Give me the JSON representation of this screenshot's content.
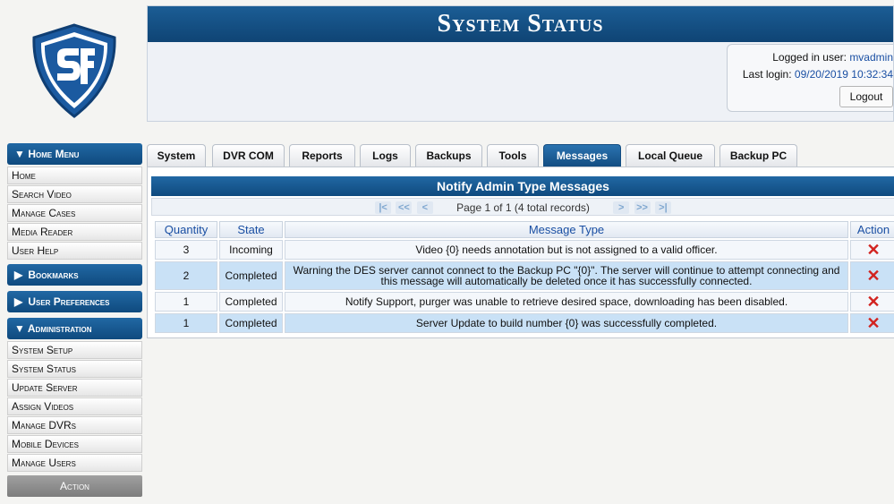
{
  "header": {
    "title": "System Status",
    "logged_in_label": "Logged in user:",
    "logged_in_user": "mvadmin",
    "last_login_label": "Last login:",
    "last_login_value": "09/20/2019 10:32:34",
    "logout_label": "Logout"
  },
  "sidebar": {
    "home_menu": {
      "label": "Home Menu",
      "items": [
        "Home",
        "Search Video",
        "Manage Cases",
        "Media Reader",
        "User Help"
      ]
    },
    "bookmarks": {
      "label": "Bookmarks"
    },
    "user_preferences": {
      "label": "User Preferences"
    },
    "administration": {
      "label": "Administration",
      "items": [
        "System Setup",
        "System Status",
        "Update Server",
        "Assign Videos",
        "Manage DVRs",
        "Mobile Devices",
        "Manage Users"
      ]
    },
    "action_label": "Action"
  },
  "tabs": [
    "System",
    "DVR COM",
    "Reports",
    "Logs",
    "Backups",
    "Tools",
    "Messages",
    "Local Queue",
    "Backup PC"
  ],
  "active_tab": "Messages",
  "panel": {
    "title": "Notify Admin Type Messages",
    "pager_text": "Page 1 of 1 (4 total records)",
    "columns": [
      "Quantity",
      "State",
      "Message Type",
      "Action"
    ],
    "rows": [
      {
        "quantity": "3",
        "state": "Incoming",
        "message": "Video {0} needs annotation but is not assigned to a valid officer."
      },
      {
        "quantity": "2",
        "state": "Completed",
        "message": "Warning the DES server cannot connect to the Backup PC \"{0}\". The server will continue to attempt connecting and this message will automatically be deleted once it has successfully connected."
      },
      {
        "quantity": "1",
        "state": "Completed",
        "message": "Notify Support, purger was unable to retrieve desired space, downloading has been disabled."
      },
      {
        "quantity": "1",
        "state": "Completed",
        "message": "Server Update to build number {0} was successfully completed."
      }
    ]
  },
  "colors": {
    "brand_blue": "#134d82",
    "delete_red": "#d2231f",
    "row_highlight": "#c9e1f6"
  },
  "icons": {
    "logo": "sf-shield-logo",
    "delete": "red-x-icon"
  }
}
